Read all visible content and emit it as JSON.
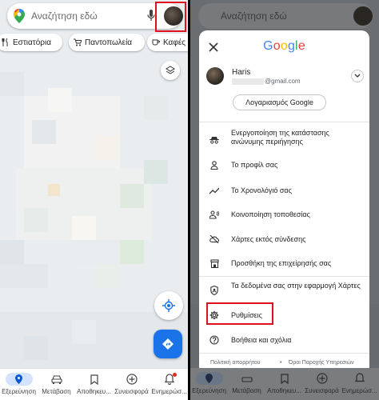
{
  "left": {
    "search": {
      "placeholder": "Αναζήτηση εδώ",
      "logo_icon": "maps-pin-icon",
      "mic_icon": "mic-icon"
    },
    "chips": [
      {
        "label": "Εστιατόρια",
        "icon": "fork-knife-icon"
      },
      {
        "label": "Παντοπωλεία",
        "icon": "cart-icon"
      },
      {
        "label": "Καφές",
        "icon": "coffee-icon"
      }
    ],
    "nav": [
      {
        "label": "Εξερεύνηση",
        "icon": "explore-pin-icon",
        "active": true
      },
      {
        "label": "Μετάβαση",
        "icon": "car-icon"
      },
      {
        "label": "Αποθηκευ...",
        "icon": "bookmark-icon"
      },
      {
        "label": "Συνεισφορά",
        "icon": "plus-circle-icon"
      },
      {
        "label": "Ενημερώσ...",
        "icon": "bell-icon"
      }
    ]
  },
  "right": {
    "search": {
      "placeholder": "Αναζήτηση εδώ"
    },
    "menu": {
      "logo": "Google",
      "account": {
        "name": "Haris",
        "email_suffix": "@gmail.com",
        "button_label": "Λογαριασμός Google"
      },
      "items": [
        {
          "label": "Ενεργοποίηση της κατάστασης ανώνυμης περιήγησης",
          "icon": "incognito-icon"
        },
        {
          "label": "Το προφίλ σας",
          "icon": "person-icon"
        },
        {
          "label": "Το Χρονολόγιό σας",
          "icon": "timeline-icon"
        },
        {
          "label": "Κοινοποίηση τοποθεσίας",
          "icon": "location-share-icon"
        },
        {
          "label": "Χάρτες εκτός σύνδεσης",
          "icon": "offline-cloud-icon"
        },
        {
          "label": "Προσθήκη της επιχείρησής σας",
          "icon": "store-icon"
        },
        {
          "label": "Τα δεδομένα σας στην εφαρμογή Χάρτες",
          "icon": "shield-icon"
        },
        {
          "label": "Ρυθμίσεις",
          "icon": "gear-icon"
        },
        {
          "label": "Βοήθεια και σχόλια",
          "icon": "help-icon"
        }
      ],
      "footer": {
        "privacy": "Πολιτική απορρήτου",
        "dot": "•",
        "terms": "Όροι Παροχής Υπηρεσιών"
      }
    },
    "nav": [
      {
        "label": "Εξερεύνηση"
      },
      {
        "label": "Μετάβαση"
      },
      {
        "label": "Αποθηκευ..."
      },
      {
        "label": "Συνεισφορά"
      },
      {
        "label": "Ενημερώσ..."
      }
    ]
  },
  "colors": {
    "highlight": "#e0101e",
    "google_blue": "#1a73e8",
    "nav_active": "#d3e3fd"
  }
}
